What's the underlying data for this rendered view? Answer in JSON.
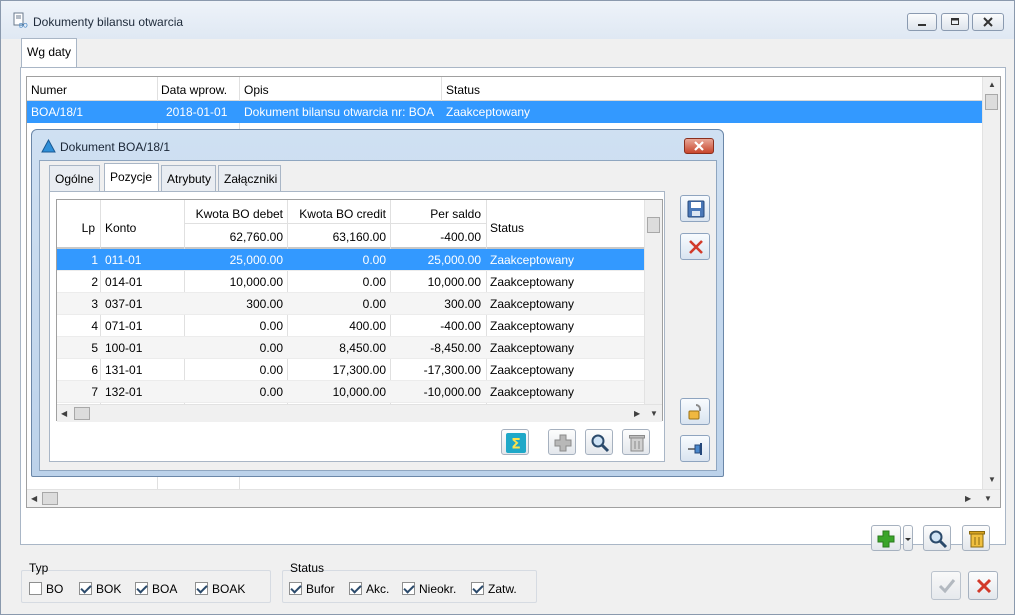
{
  "window": {
    "title": "Dokumenty bilansu otwarcia"
  },
  "main_tabs": [
    {
      "label": "Wg daty"
    }
  ],
  "doc_grid": {
    "columns": [
      "Numer",
      "Data wprow.",
      "Opis",
      "Status"
    ],
    "rows": [
      {
        "numer": "BOA/18/1",
        "data": "2018-01-01",
        "opis": "Dokument bilansu otwarcia nr: BOA",
        "status": "Zaakceptowany"
      }
    ]
  },
  "filters": {
    "typ": {
      "label": "Typ",
      "items": [
        {
          "label": "BO",
          "checked": false
        },
        {
          "label": "BOK",
          "checked": true
        },
        {
          "label": "BOA",
          "checked": true
        },
        {
          "label": "BOAK",
          "checked": true
        }
      ]
    },
    "status": {
      "label": "Status",
      "items": [
        {
          "label": "Bufor",
          "checked": true
        },
        {
          "label": "Akc.",
          "checked": true
        },
        {
          "label": "Nieokr.",
          "checked": true
        },
        {
          "label": "Zatw.",
          "checked": true
        }
      ]
    }
  },
  "dialog": {
    "title": "Dokument BOA/18/1",
    "tabs": [
      {
        "label": "Ogólne"
      },
      {
        "label": "Pozycje"
      },
      {
        "label": "Atrybuty"
      },
      {
        "label": "Załączniki"
      }
    ],
    "active_tab": "Pozycje",
    "grid": {
      "columns": [
        "Lp",
        "Konto",
        "Kwota BO debet",
        "Kwota BO credit",
        "Per saldo",
        "Status"
      ],
      "totals": {
        "debet": "62,760.00",
        "credit": "63,160.00",
        "saldo": "-400.00"
      },
      "rows": [
        {
          "lp": "1",
          "konto": "011-01",
          "debet": "25,000.00",
          "credit": "0.00",
          "saldo": "25,000.00",
          "status": "Zaakceptowany"
        },
        {
          "lp": "2",
          "konto": "014-01",
          "debet": "10,000.00",
          "credit": "0.00",
          "saldo": "10,000.00",
          "status": "Zaakceptowany"
        },
        {
          "lp": "3",
          "konto": "037-01",
          "debet": "300.00",
          "credit": "0.00",
          "saldo": "300.00",
          "status": "Zaakceptowany"
        },
        {
          "lp": "4",
          "konto": "071-01",
          "debet": "0.00",
          "credit": "400.00",
          "saldo": "-400.00",
          "status": "Zaakceptowany"
        },
        {
          "lp": "5",
          "konto": "100-01",
          "debet": "0.00",
          "credit": "8,450.00",
          "saldo": "-8,450.00",
          "status": "Zaakceptowany"
        },
        {
          "lp": "6",
          "konto": "131-01",
          "debet": "0.00",
          "credit": "17,300.00",
          "saldo": "-17,300.00",
          "status": "Zaakceptowany"
        },
        {
          "lp": "7",
          "konto": "132-01",
          "debet": "0.00",
          "credit": "10,000.00",
          "saldo": "-10,000.00",
          "status": "Zaakceptowany"
        }
      ]
    }
  },
  "icons": {
    "sum": "sigma-icon",
    "add": "plus-icon",
    "preview": "magnifier-icon",
    "delete": "trash-icon",
    "save": "save-icon",
    "cancel": "x-icon",
    "lock": "padlock-icon",
    "pin": "pin-icon",
    "confirm": "checkmark-icon"
  },
  "colors": {
    "selection": "#3399ff",
    "accent": "#2f79c0",
    "danger": "#d23a2a",
    "add_green": "#3aa52a"
  }
}
